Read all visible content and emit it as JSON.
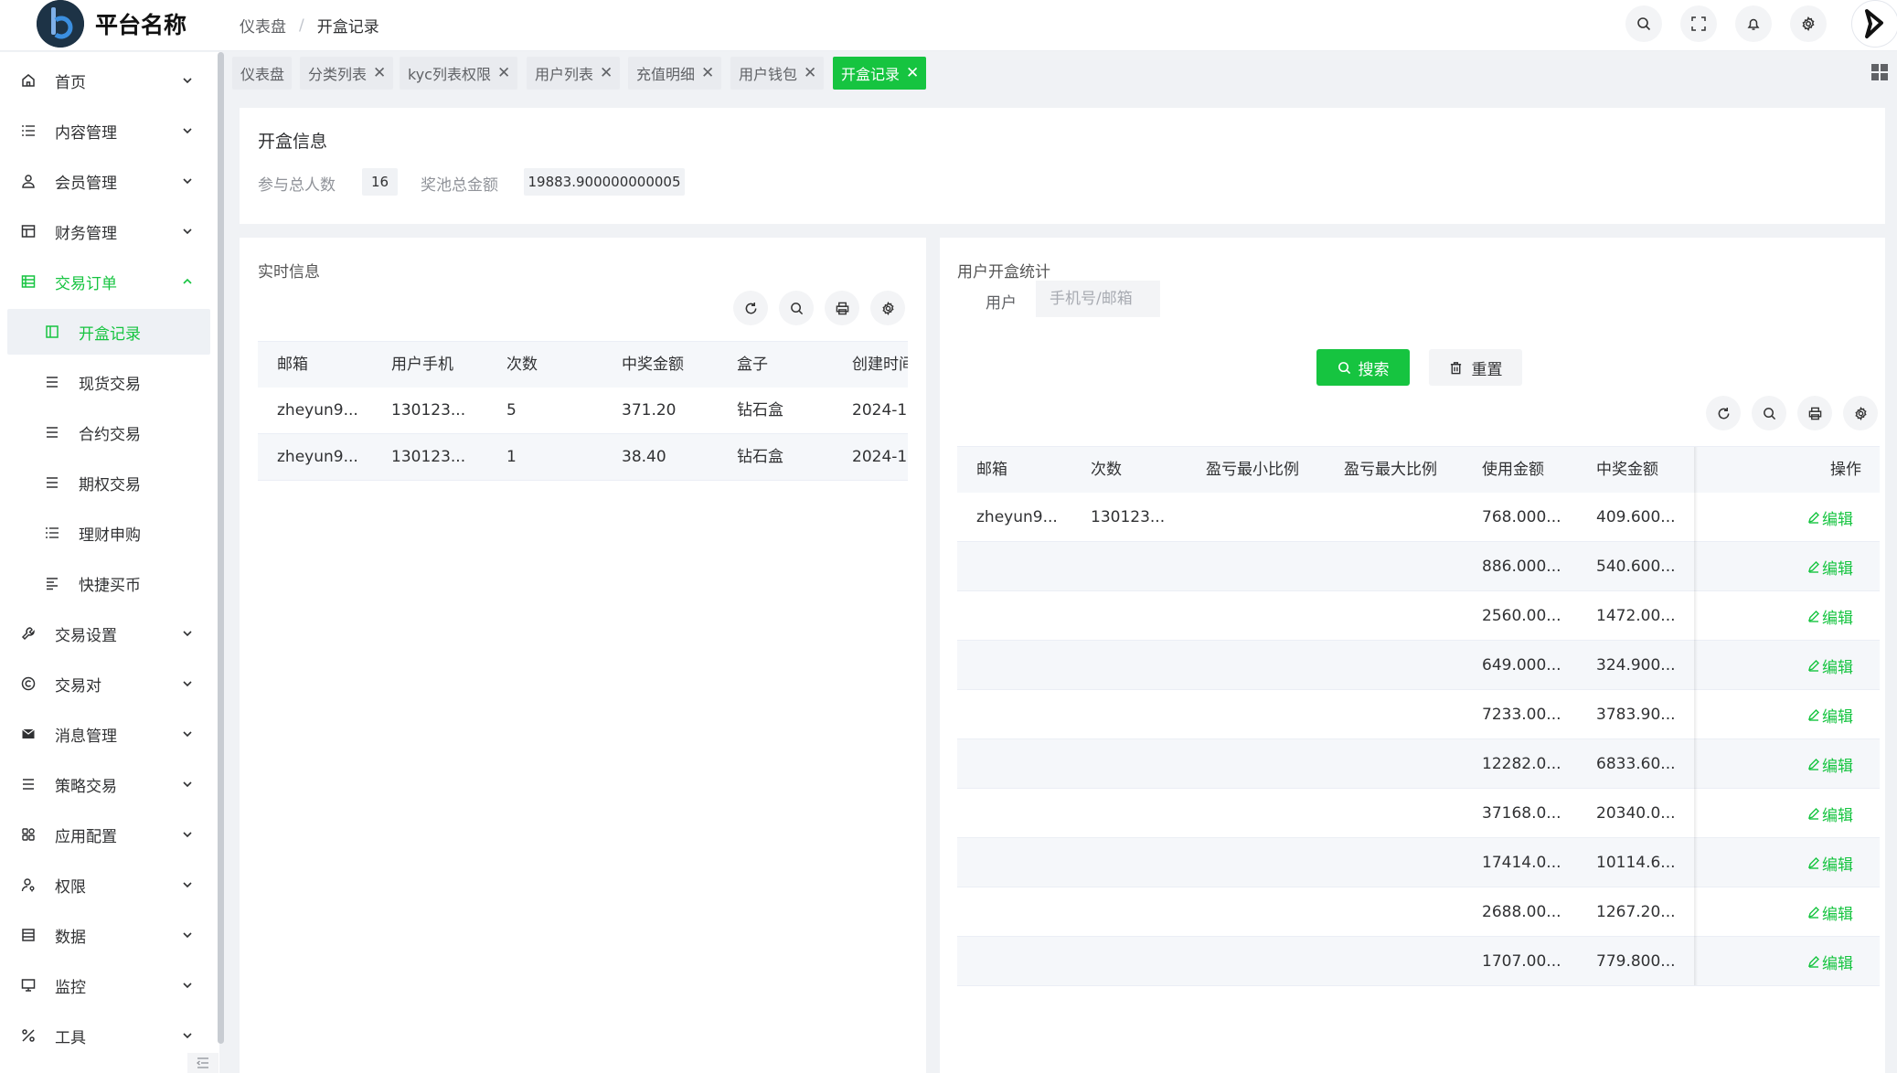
{
  "header": {
    "platform_name": "平台名称",
    "breadcrumb": [
      "仪表盘",
      "开盒记录"
    ],
    "separator": "/"
  },
  "icons": {
    "search": "search-icon",
    "fullscreen": "fullscreen-icon",
    "bell": "bell-icon",
    "settings": "gear-icon"
  },
  "colors": {
    "accent": "#16c440",
    "sidebar_bg": "#ffffff",
    "page_bg": "#f0f2f5"
  },
  "sidebar": {
    "items": [
      {
        "label": "首页",
        "icon": "home-icon"
      },
      {
        "label": "内容管理",
        "icon": "list-icon"
      },
      {
        "label": "会员管理",
        "icon": "user-icon"
      },
      {
        "label": "财务管理",
        "icon": "table-icon"
      },
      {
        "label": "交易订单",
        "icon": "grid-list-icon",
        "expanded": true,
        "children": [
          {
            "label": "开盒记录",
            "icon": "panel-icon",
            "active": true
          },
          {
            "label": "现货交易",
            "icon": "lines-icon"
          },
          {
            "label": "合约交易",
            "icon": "lines-icon"
          },
          {
            "label": "期权交易",
            "icon": "lines-icon"
          },
          {
            "label": "理财申购",
            "icon": "list-icon"
          },
          {
            "label": "快捷买币",
            "icon": "align-left-icon"
          }
        ]
      },
      {
        "label": "交易设置",
        "icon": "wrench-icon"
      },
      {
        "label": "交易对",
        "icon": "copyright-icon"
      },
      {
        "label": "消息管理",
        "icon": "mail-icon"
      },
      {
        "label": "策略交易",
        "icon": "lines-icon"
      },
      {
        "label": "应用配置",
        "icon": "app-config-icon"
      },
      {
        "label": "权限",
        "icon": "user-key-icon"
      },
      {
        "label": "数据",
        "icon": "database-icon"
      },
      {
        "label": "监控",
        "icon": "monitor-icon"
      },
      {
        "label": "工具",
        "icon": "tools-icon"
      }
    ]
  },
  "tabs": [
    {
      "label": "仪表盘",
      "closable": false
    },
    {
      "label": "分类列表",
      "closable": true
    },
    {
      "label": "kyc列表权限",
      "closable": true
    },
    {
      "label": "用户列表",
      "closable": true
    },
    {
      "label": "充值明细",
      "closable": true
    },
    {
      "label": "用户钱包",
      "closable": true
    },
    {
      "label": "开盒记录",
      "closable": true,
      "active": true
    }
  ],
  "close_glyph": "✕",
  "info": {
    "title": "开盒信息",
    "participants_label": "参与总人数",
    "participants_value": "16",
    "pool_label": "奖池总金额",
    "pool_value": "19883.900000000005"
  },
  "realtime": {
    "title": "实时信息",
    "columns": [
      "邮箱",
      "用户手机",
      "次数",
      "中奖金额",
      "盒子",
      "创建时间"
    ],
    "rows": [
      [
        "zheyun9...",
        "130123...",
        "5",
        "371.20",
        "钻石盒",
        "2024-1"
      ],
      [
        "zheyun9...",
        "130123...",
        "1",
        "38.40",
        "钻石盒",
        "2024-1"
      ]
    ]
  },
  "stats": {
    "title": "用户开盒统计",
    "user_label": "用户",
    "user_placeholder": "手机号/邮箱",
    "search_label": "搜索",
    "reset_label": "重置",
    "columns": [
      "邮箱",
      "次数",
      "盈亏最小比例",
      "盈亏最大比例",
      "使用金额",
      "中奖金额",
      "操作"
    ],
    "edit_label": "编辑",
    "rows": [
      [
        "zheyun9...",
        "130123...",
        "",
        "",
        "768.000...",
        "409.600..."
      ],
      [
        "",
        "",
        "",
        "",
        "886.000...",
        "540.600..."
      ],
      [
        "",
        "",
        "",
        "",
        "2560.00...",
        "1472.00..."
      ],
      [
        "",
        "",
        "",
        "",
        "649.000...",
        "324.900..."
      ],
      [
        "",
        "",
        "",
        "",
        "7233.00...",
        "3783.90..."
      ],
      [
        "",
        "",
        "",
        "",
        "12282.0...",
        "6833.60..."
      ],
      [
        "",
        "",
        "",
        "",
        "37168.0...",
        "20340.0..."
      ],
      [
        "",
        "",
        "",
        "",
        "17414.0...",
        "10114.6..."
      ],
      [
        "",
        "",
        "",
        "",
        "2688.00...",
        "1267.20..."
      ],
      [
        "",
        "",
        "",
        "",
        "1707.00...",
        "779.800..."
      ]
    ]
  }
}
